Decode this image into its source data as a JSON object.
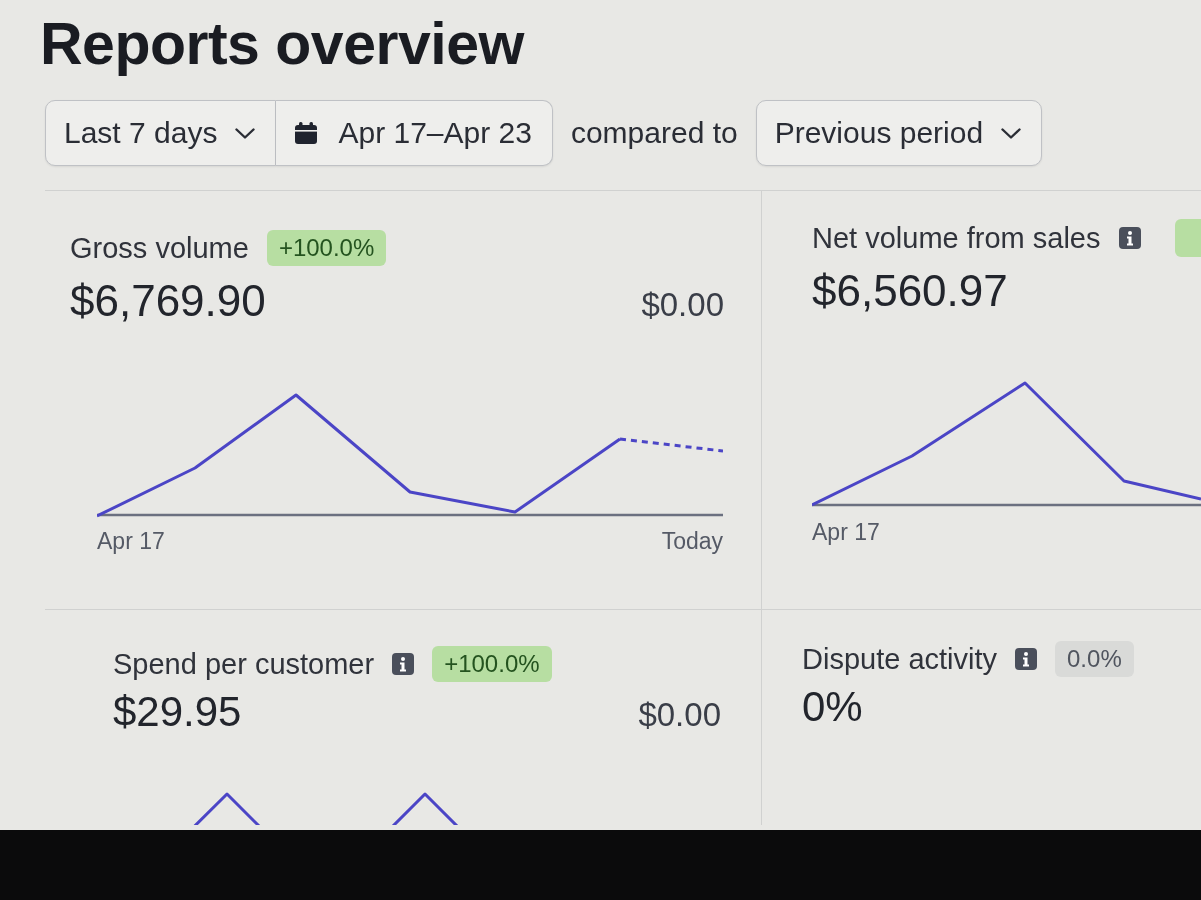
{
  "page": {
    "title": "Reports overview"
  },
  "filters": {
    "range": {
      "label": "Last 7 days"
    },
    "dates": {
      "label": "Apr 17–Apr 23"
    },
    "compare_label": "compared to",
    "comparison": {
      "label": "Previous period"
    }
  },
  "metrics": [
    {
      "title": "Gross volume",
      "info": false,
      "badge": {
        "text": "+100.0%",
        "kind": "positive"
      },
      "value": "$6,769.90",
      "previous": "$0.00",
      "sparkline": true,
      "start_label": "Apr 17",
      "end_label": "Today"
    },
    {
      "title": "Net volume from sales",
      "info": true,
      "badge": {
        "kind": "positive"
      },
      "value": "$6,560.97",
      "sparkline": true,
      "start_label": "Apr 17"
    },
    {
      "title": "Spend per customer",
      "info": true,
      "badge": {
        "text": "+100.0%",
        "kind": "positive"
      },
      "value": "$29.95",
      "previous": "$0.00",
      "sparkline": true
    },
    {
      "title": "Dispute activity",
      "info": true,
      "badge": {
        "text": "0.0%",
        "kind": "neutral"
      },
      "value": "0%",
      "sparkline": false
    }
  ]
}
